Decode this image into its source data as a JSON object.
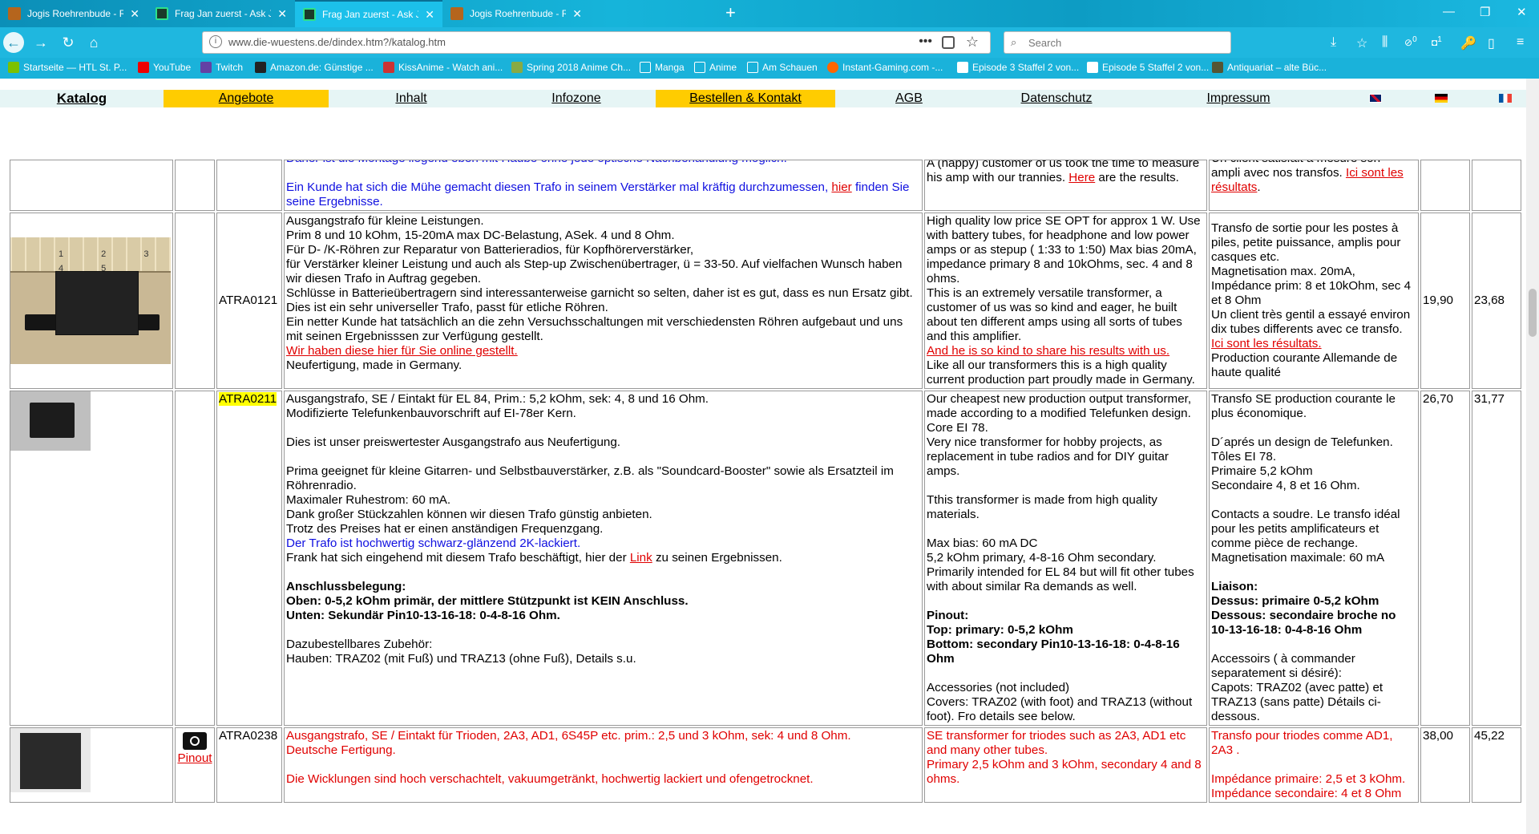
{
  "browser": {
    "tabs": [
      {
        "title": "Jogis Roehrenbude - Roehrenang",
        "active": false
      },
      {
        "title": "Frag Jan zuerst - Ask Jan first: Ra",
        "active": false
      },
      {
        "title": "Frag Jan zuerst - Ask Jan first: Ra",
        "active": true
      },
      {
        "title": "Jogis Roehrenbude - Roehrenang",
        "active": false
      }
    ],
    "url": "www.die-wuestens.de/dindex.htm?/katalog.htm",
    "search_placeholder": "Search",
    "bookmarks": [
      "Startseite — HTL St. P...",
      "YouTube",
      "Twitch",
      "Amazon.de: Günstige ...",
      "KissAnime - Watch ani...",
      "Spring 2018 Anime Ch...",
      "Manga",
      "Anime",
      "Am Schauen",
      "Instant-Gaming.com -...",
      "Episode 3 Staffel 2 von...",
      "Episode 5 Staffel 2 von...",
      "Antiquariat – alte Büc..."
    ],
    "badges": {
      "downloads": "0",
      "ublock": "1"
    },
    "colors": {
      "chrome": "#1fb7df",
      "highlight": "#ffcc00"
    }
  },
  "site_menu": {
    "items": [
      "Katalog",
      "Angebote",
      "Inhalt",
      "Infozone",
      "Bestellen & Kontakt",
      "AGB",
      "Datenschutz",
      "Impressum"
    ]
  },
  "catalog": {
    "row_prev": {
      "de_cut": "Daher ist die Montage liegend eben mit Haube ohne jede optische Nachbehandlung möglich.",
      "de_kunde_pre": "Ein Kunde hat sich die Mühe gemacht diesen Trafo in seinem Verstärker mal kräftig durchzumessen, ",
      "de_kunde_link": "hier",
      "de_kunde_post": " finden Sie seine Ergebnisse.",
      "en_1": "A (happy) customer of us took the time to measure his amp with our trannies. ",
      "en_link": "Here",
      "en_2": " are the results.",
      "fr_cut": "Un client satisfait a mesuré son",
      "fr_1": "ampli avec nos transfos. ",
      "fr_link": "Ici sont les résultats",
      "fr_2": "."
    },
    "row_0121": {
      "code": "ATRA0121",
      "de": [
        "Ausgangstrafo für kleine Leistungen.",
        "Prim 8 und 10 kOhm, 15-20mA max DC-Belastung, ASek. 4 und 8 Ohm.",
        "Für D- /K-Röhren zur Reparatur von Batterieradios, für Kopfhörerverstärker,",
        "für Verstärker kleiner Leistung und auch als Step-up Zwischenübertrager, ü = 33-50. Auf vielfachen Wunsch haben wir diesen Trafo in Auftrag gegeben.",
        "Schlüsse in Batterieübertragern sind interessanterweise garnicht so selten, daher ist es gut, dass es nun Ersatz gibt.",
        "Dies ist ein sehr universeller Trafo, passt für etliche Röhren.",
        "Ein netter Kunde hat tatsächlich an die zehn Versuchsschaltungen mit verschiedensten Röhren aufgebaut und uns mit seinen Ergebnisssen zur Verfügung gestellt."
      ],
      "de_link": "Wir haben diese hier für Sie online gestellt.",
      "de_end": "Neufertigung, made in Germany.",
      "en": [
        "High quality low price SE OPT for approx 1 W. Use with battery tubes, for headphone and low power amps or as stepup ( 1:33 to 1:50) Max bias 20mA, impedance primary 8 and 10kOhms, sec. 4 and 8 ohms.",
        "This is an extremely versatile transformer, a customer of us was so kind and eager, he built about ten different amps using all sorts of tubes and this amplifier."
      ],
      "en_link": "And he is so kind to share his results with us.",
      "en_end": "Like all our transformers this is a high quality current production part proudly made in Germany.",
      "fr_1": "Transfo de sortie pour les postes à piles, petite puissance, amplis pour casques etc.",
      "fr_2": "Magnetisation max. 20mA,",
      "fr_3": "Impédance prim: 8 et 10kOhm, sec 4 et 8 Ohm",
      "fr_4": "Un client très gentil a essayé environ dix tubes differents avec ce transfo. ",
      "fr_link": "Ici sont les résultats.",
      "fr_5": "Production courante Allemande de haute qualité",
      "price1": "19,90",
      "price2": "23,68",
      "ruler_labels": "1  2  3  4  5"
    },
    "row_0211": {
      "code": "ATRA0211",
      "de_1": "Ausgangstrafo, SE / Eintakt für EL 84, Prim.: 5,2 kOhm, sek: 4, 8 und 16 Ohm.",
      "de_2": "Modifizierte Telefunkenbauvorschrift auf EI-78er Kern.",
      "de_3": "Dies ist unser preiswertester Ausgangstrafo aus Neufertigung.",
      "de_4": "Prima geeignet für kleine Gitarren- und Selbstbauverstärker, z.B. als \"Soundcard-Booster\" sowie als Ersatzteil im Röhrenradio.",
      "de_5": "Maximaler Ruhestrom: 60 mA.",
      "de_6": "Dank großer Stückzahlen können wir diesen Trafo  günstig anbieten.",
      "de_7": "Trotz des Preises hat er einen anständigen Frequenzgang.",
      "de_blue": "Der Trafo ist hochwertig schwarz-glänzend 2K-lackiert.",
      "de_8_pre": "Frank hat sich eingehend mit diesem Trafo beschäftigt, hier der ",
      "de_8_link": "Link",
      "de_8_post": " zu seinen Ergebnissen.",
      "de_b1": "Anschlussbelegung:",
      "de_b2": "Oben: 0-5,2 kOhm primär, der mittlere Stützpunkt ist KEIN Anschluss.",
      "de_b3": "Unten: Sekundär Pin10-13-16-18: 0-4-8-16 Ohm.",
      "de_9": "Dazubestellbares Zubehör:",
      "de_10": "Hauben: TRAZ02 (mit Fuß) und TRAZ13 (ohne Fuß), Details s.u.",
      "en_1": "Our cheapest new production output transformer, made according to a modified Telefunken design.",
      "en_2": "Core EI 78.",
      "en_3": "Very nice transformer for hobby projects, as replacement in tube radios and for DIY guitar amps.",
      "en_4": "Tthis transformer is made from high quality materials.",
      "en_5": "Max bias: 60 mA DC",
      "en_6": "5,2 kOhm primary, 4-8-16 Ohm secondary.",
      "en_7": "Primarily intended for EL 84 but will fit other tubes with about similar Ra demands as well.",
      "en_b1": "Pinout:",
      "en_b2": "Top: primary: 0-5,2 kOhm",
      "en_b3": "Bottom: secondary Pin10-13-16-18: 0-4-8-16 Ohm",
      "en_8": "Accessories (not included)",
      "en_9": "Covers: TRAZ02 (with foot) and TRAZ13 (without foot). Fro details see below.",
      "fr_1": "Transfo SE production courante le plus économique.",
      "fr_2": "D´aprés un design de Telefunken.",
      "fr_3": "Tôles EI 78.",
      "fr_4": "Primaire 5,2 kOhm",
      "fr_5": "Secondaire 4, 8 et 16 Ohm.",
      "fr_6": "Contacts a soudre. Le transfo idéal pour les petits amplificateurs et comme pièce de rechange.",
      "fr_7": "Magnetisation maximale: 60 mA",
      "fr_b1": "Liaison:",
      "fr_b2": "Dessus: primaire 0-5,2 kOhm",
      "fr_b3": "Dessous: secondaire broche no 10-13-16-18: 0-4-8-16 Ohm",
      "fr_8": "Accessoirs ( à commander separatement si désiré):",
      "fr_9": "Capots: TRAZ02 (avec patte) et TRAZ13 (sans patte) Détails ci-dessous.",
      "price1": "26,70",
      "price2": "31,77"
    },
    "row_0238": {
      "code": "ATRA0238",
      "pinout_label": "Pinout",
      "de_1": "Ausgangstrafo, SE / Eintakt für Trioden, 2A3, AD1, 6S45P etc. prim.: 2,5 und 3 kOhm, sek: 4 und 8 Ohm.",
      "de_2": "Deutsche Fertigung.",
      "de_3": "Die Wicklungen sind hoch verschachtelt, vakuumgetränkt, hochwertig lackiert und ofengetrocknet.",
      "en_1": "SE transformer for triodes such as 2A3, AD1 etc and many other tubes.",
      "en_2": "Primary 2,5 kOhm and 3 kOhm, secondary 4 and 8 ohms.",
      "fr_1": "Transfo pour triodes comme AD1, 2A3 .",
      "fr_2": "Impédance primaire: 2,5 et 3 kOhm.",
      "fr_3": "Impédance secondaire: 4 et 8 Ohm",
      "price1": "38,00",
      "price2": "45,22"
    }
  }
}
